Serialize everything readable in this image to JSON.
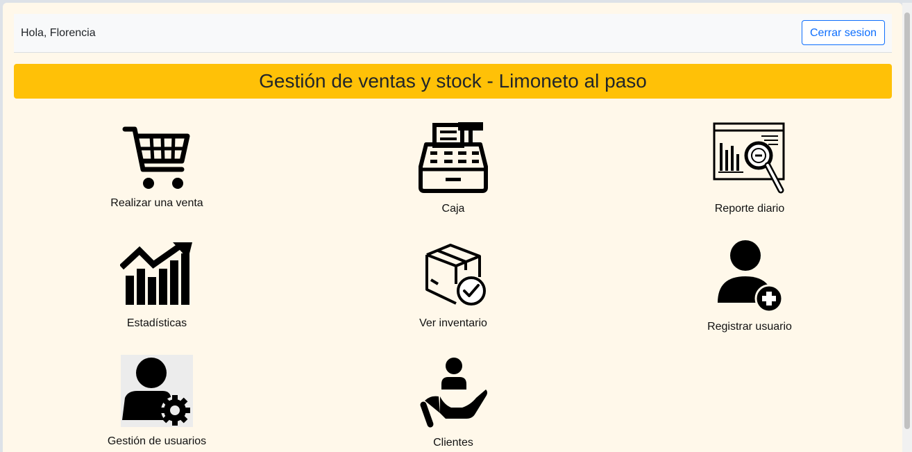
{
  "header": {
    "greeting": "Hola, Florencia",
    "logout_label": "Cerrar sesion"
  },
  "banner": {
    "title": "Gestión de ventas y stock - Limoneto al paso"
  },
  "menu": [
    {
      "label": "Realizar una venta",
      "icon": "shopping-cart-icon"
    },
    {
      "label": "Caja",
      "icon": "cash-register-icon"
    },
    {
      "label": "Reporte diario",
      "icon": "report-search-icon"
    },
    {
      "label": "Estadísticas",
      "icon": "growth-chart-icon"
    },
    {
      "label": "Ver inventario",
      "icon": "box-check-icon"
    },
    {
      "label": "Registrar usuario",
      "icon": "add-user-icon"
    },
    {
      "label": "Gestión de usuarios",
      "icon": "user-settings-icon"
    },
    {
      "label": "Clientes",
      "icon": "client-hand-icon"
    }
  ],
  "colors": {
    "background": "#fff8ea",
    "banner": "#ffc107",
    "accent": "#0d6efd"
  }
}
